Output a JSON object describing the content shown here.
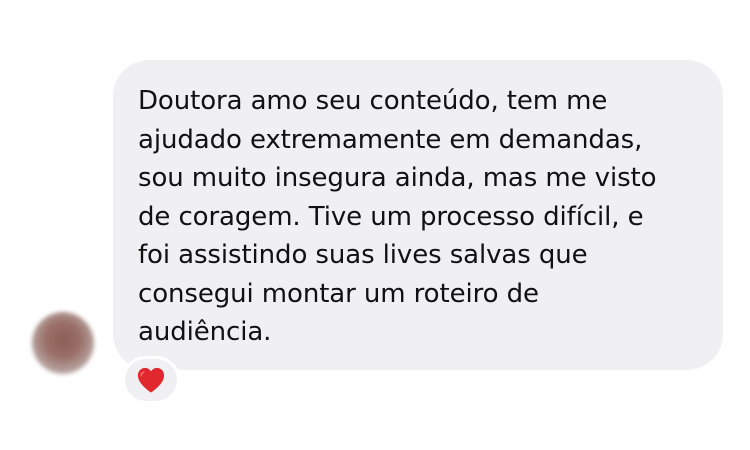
{
  "message": {
    "text": "Doutora amo seu conteúdo, tem me\najudado extremamente em demandas,\nsou muito insegura ainda, mas me visto\nde coragem. Tive um processo difícil, e\nfoi assistindo suas lives salvas que\nconsegui montar um roteiro de\naudiência."
  },
  "reaction": {
    "icon": "heart-icon",
    "color": "#e0282e"
  },
  "colors": {
    "bubble": "#f0f0f2",
    "text": "#111111",
    "background": "#ffffff"
  }
}
